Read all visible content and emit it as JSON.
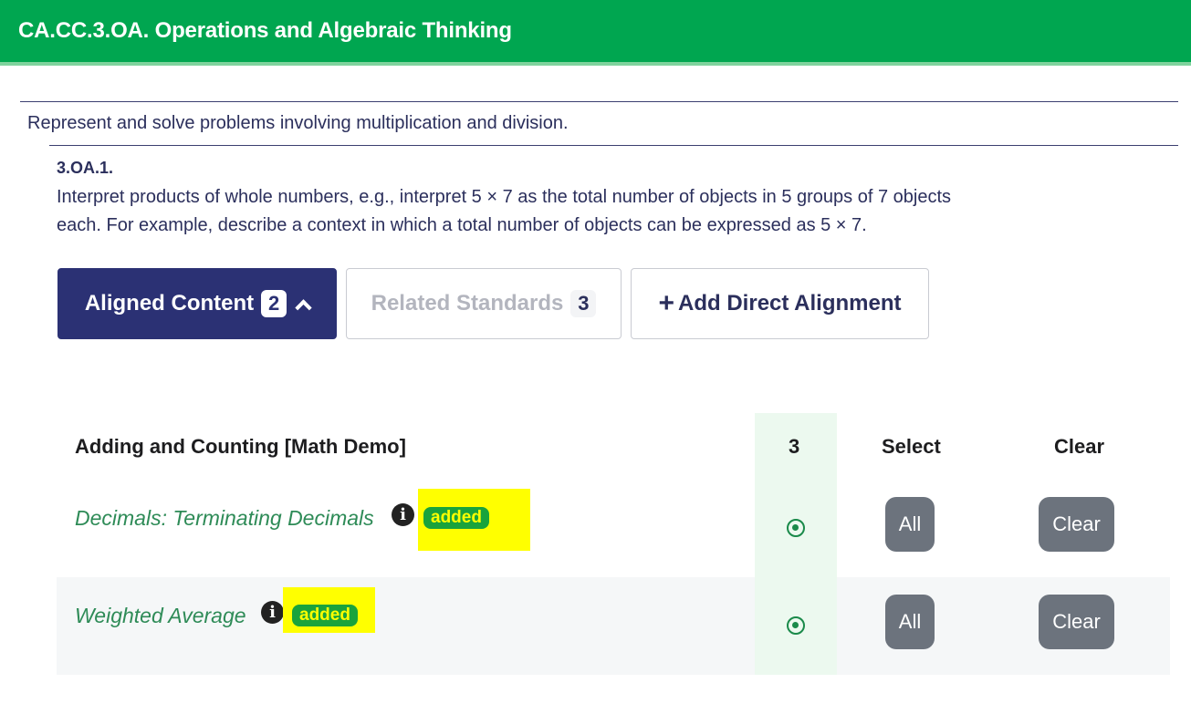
{
  "header": {
    "title": "CA.CC.3.OA. Operations and Algebraic Thinking"
  },
  "cluster": {
    "text": "Represent and solve problems involving multiplication and division."
  },
  "standard": {
    "code": "3.OA.1.",
    "description": "Interpret products of whole numbers, e.g., interpret 5 × 7 as the total number of objects in 5 groups of 7 objects each. For example, describe a context in which a total number of objects can be expressed as 5 × 7."
  },
  "tabs": {
    "aligned": {
      "label": "Aligned Content",
      "count": "2"
    },
    "related": {
      "label": "Related Standards",
      "count": "3"
    },
    "add": {
      "label": "Add Direct Alignment"
    }
  },
  "table": {
    "headers": {
      "name": "Adding and Counting [Math Demo]",
      "count": "3",
      "select": "Select",
      "clear": "Clear"
    },
    "rows": [
      {
        "name": "Decimals: Terminating Decimals",
        "badge": "added",
        "all_label": "All",
        "clear_label": "Clear"
      },
      {
        "name": "Weighted Average",
        "badge": "added",
        "all_label": "All",
        "clear_label": "Clear"
      }
    ]
  },
  "colors": {
    "header_green": "#00a650",
    "primary_navy": "#2b3174",
    "link_green": "#2e8b57",
    "highlight_yellow": "#ffff00"
  },
  "icons": {
    "info": "info-icon",
    "chevron": "chevron-up-icon",
    "plus": "plus-icon",
    "radio": "radio-selected-icon"
  }
}
